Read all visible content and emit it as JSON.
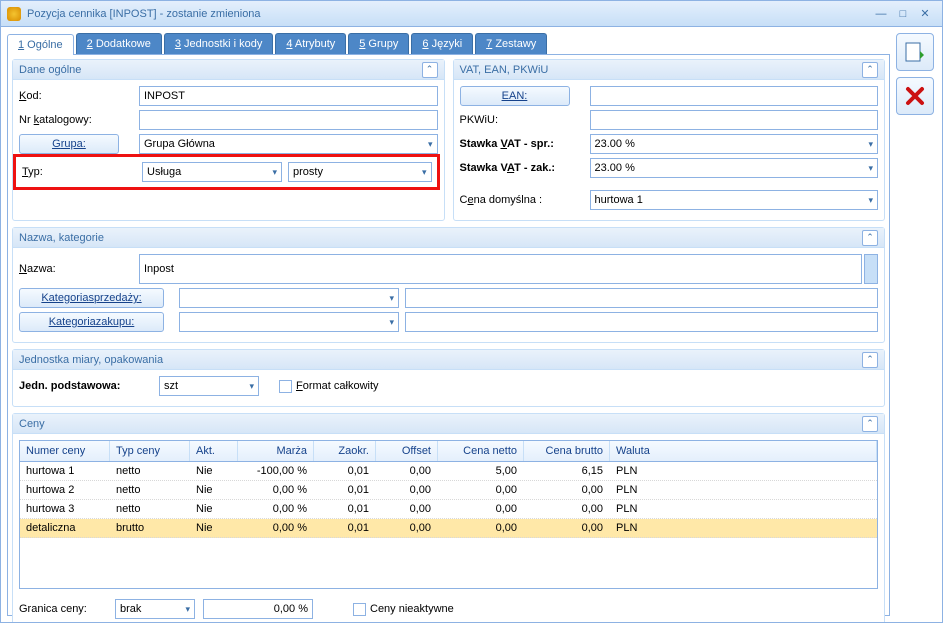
{
  "title": "Pozycja cennika [INPOST] - zostanie zmieniona",
  "tabs": [
    "1 Ogólne",
    "2 Dodatkowe",
    "3 Jednostki i kody",
    "4 Atrybuty",
    "5 Grupy",
    "6 Języki",
    "7 Zestawy"
  ],
  "activeTab": 0,
  "dane": {
    "header": "Dane ogólne",
    "kod_label": "Kod:",
    "kod_u": "K",
    "kod": "INPOST",
    "nrkat_label": "Nr katalogowy:",
    "nrkat_u": "k",
    "nrkat": "",
    "grupa_btn": "Grupa:",
    "grupa": "Grupa Główna",
    "typ_label": "Typ:",
    "typ_u": "T",
    "typ1": "Usługa",
    "typ2": "prosty"
  },
  "vat": {
    "header": "VAT, EAN, PKWiU",
    "ean_btn": "EAN:",
    "ean": "",
    "pkwiu_label": "PKWiU:",
    "pkwiu": "",
    "vat_spr_label": "Stawka VAT - spr.:",
    "vat_spr_u": "V",
    "vat_spr": "23.00 %",
    "vat_zak_label": "Stawka VAT - zak.:",
    "vat_zak_u": "A",
    "vat_zak": "23.00 %",
    "cena_def_label": "Cena domyślna :",
    "cena_def_u": "e",
    "cena_def": "hurtowa 1"
  },
  "nazwa": {
    "header": "Nazwa, kategorie",
    "nazwa_label": "Nazwa:",
    "nazwa_u": "N",
    "nazwa": "Inpost",
    "kat_sprz_btn": "Kategoria sprzedaży:",
    "kat_sprz_u": "s",
    "kat_sprz": "",
    "kat_zak_btn": "Kategoria zakupu:",
    "kat_zak_u": "z",
    "kat_zak": ""
  },
  "jedn": {
    "header": "Jednostka miary, opakowania",
    "label": "Jedn. podstawowa:",
    "val": "szt",
    "format_label": "Format całkowity",
    "format_u": "F"
  },
  "ceny": {
    "header": "Ceny",
    "cols": [
      "Numer ceny",
      "Typ ceny",
      "Akt.",
      "Marża",
      "Zaokr.",
      "Offset",
      "Cena netto",
      "Cena brutto",
      "Waluta"
    ],
    "rows": [
      {
        "num": "hurtowa 1",
        "typ": "netto",
        "akt": "Nie",
        "marza": "-100,00 %",
        "zaokr": "0,01",
        "offset": "0,00",
        "netto": "5,00",
        "brutto": "6,15",
        "wal": "PLN",
        "sel": false
      },
      {
        "num": "hurtowa 2",
        "typ": "netto",
        "akt": "Nie",
        "marza": "0,00 %",
        "zaokr": "0,01",
        "offset": "0,00",
        "netto": "0,00",
        "brutto": "0,00",
        "wal": "PLN",
        "sel": false
      },
      {
        "num": "hurtowa 3",
        "typ": "netto",
        "akt": "Nie",
        "marza": "0,00 %",
        "zaokr": "0,01",
        "offset": "0,00",
        "netto": "0,00",
        "brutto": "0,00",
        "wal": "PLN",
        "sel": false
      },
      {
        "num": "detaliczna",
        "typ": "brutto",
        "akt": "Nie",
        "marza": "0,00 %",
        "zaokr": "0,01",
        "offset": "0,00",
        "netto": "0,00",
        "brutto": "0,00",
        "wal": "PLN",
        "sel": true
      }
    ],
    "granica_label": "Granica ceny:",
    "granica": "brak",
    "granica_pct": "0,00 %",
    "nieakt_label": "Ceny nieaktywne"
  }
}
